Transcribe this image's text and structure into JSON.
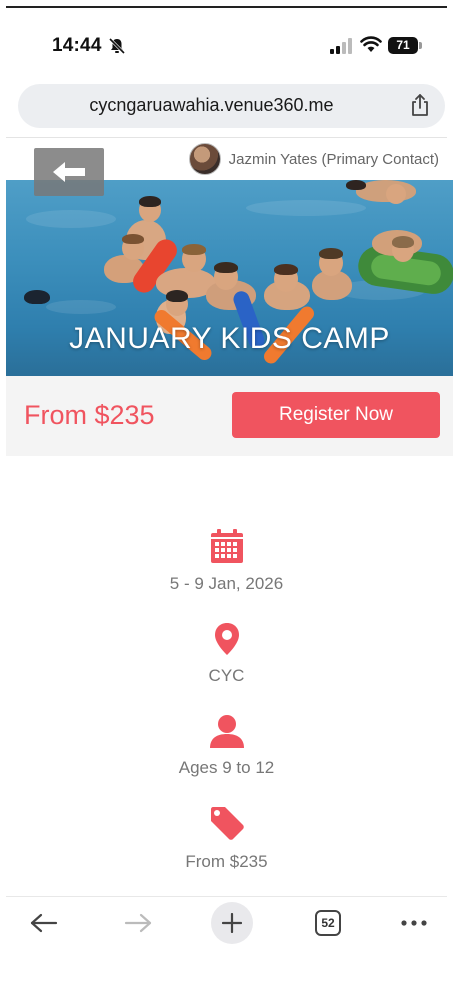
{
  "status_bar": {
    "time": "14:44",
    "battery": "71"
  },
  "browser": {
    "url": "cycngaruawahia.venue360.me",
    "tabs_count": "52"
  },
  "contact": {
    "name": "Jazmin Yates (Primary Contact)"
  },
  "hero": {
    "title": "JANUARY KIDS CAMP"
  },
  "pricing": {
    "price": "From $235",
    "register_label": "Register Now"
  },
  "details": {
    "dates": "5 - 9 Jan, 2026",
    "location": "CYC",
    "ages": "Ages 9 to 12",
    "price": "From $235"
  },
  "theme": {
    "accent": "#f0545f"
  },
  "icons": {
    "date": "calendar-icon",
    "location": "map-pin-icon",
    "ages": "person-icon",
    "price": "price-tag-icon"
  }
}
